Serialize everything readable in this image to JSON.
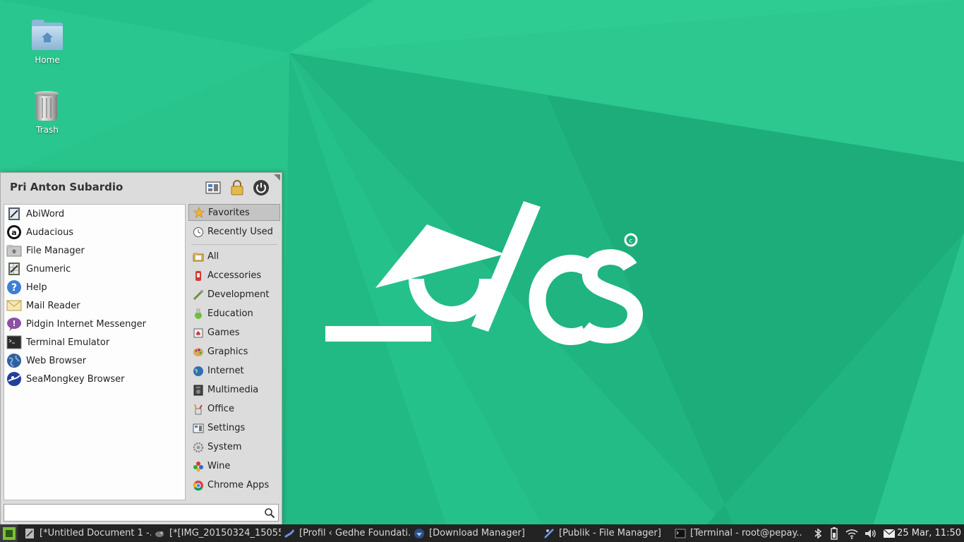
{
  "desktop": {
    "icons": [
      {
        "label": "Home",
        "icon": "home-folder-icon"
      },
      {
        "label": "Trash",
        "icon": "trash-icon"
      }
    ],
    "colors": {
      "background": "#25c18b",
      "logo": "#ffffff"
    }
  },
  "menu": {
    "user_name": "Pri Anton Subardio",
    "favorites": [
      {
        "label": "AbiWord",
        "icon": "abiword-icon"
      },
      {
        "label": "Audacious",
        "icon": "audacious-icon"
      },
      {
        "label": "File Manager",
        "icon": "file-manager-icon"
      },
      {
        "label": "Gnumeric",
        "icon": "gnumeric-icon"
      },
      {
        "label": "Help",
        "icon": "help-icon"
      },
      {
        "label": "Mail Reader",
        "icon": "mail-icon"
      },
      {
        "label": "Pidgin Internet Messenger",
        "icon": "pidgin-icon"
      },
      {
        "label": "Terminal Emulator",
        "icon": "terminal-icon"
      },
      {
        "label": "Web Browser",
        "icon": "web-browser-icon"
      },
      {
        "label": "SeaMongkey Browser",
        "icon": "seamonkey-icon"
      }
    ],
    "categories": [
      {
        "label": "Favorites",
        "icon": "star-icon"
      },
      {
        "label": "Recently Used",
        "icon": "clock-icon"
      },
      {
        "label": "All",
        "icon": "folder-icon"
      },
      {
        "label": "Accessories",
        "icon": "accessories-icon"
      },
      {
        "label": "Development",
        "icon": "development-icon"
      },
      {
        "label": "Education",
        "icon": "education-icon"
      },
      {
        "label": "Games",
        "icon": "games-icon"
      },
      {
        "label": "Graphics",
        "icon": "graphics-icon"
      },
      {
        "label": "Internet",
        "icon": "globe-icon"
      },
      {
        "label": "Multimedia",
        "icon": "multimedia-icon"
      },
      {
        "label": "Office",
        "icon": "office-icon"
      },
      {
        "label": "Settings",
        "icon": "settings-icon"
      },
      {
        "label": "System",
        "icon": "gear-icon"
      },
      {
        "label": "Wine",
        "icon": "wine-icon"
      },
      {
        "label": "Chrome Apps",
        "icon": "chrome-icon"
      }
    ],
    "search_placeholder": ""
  },
  "taskbar": {
    "tasks": [
      {
        "label": "[*Untitled Document 1 -...",
        "icon": "text-editor-icon"
      },
      {
        "label": "[*[IMG_20150324_15055...",
        "icon": "image-editor-icon"
      },
      {
        "label": "[Profil ‹ Gedhe Foundati...",
        "icon": "seamonkey-icon"
      },
      {
        "label": "[Download Manager]",
        "icon": "download-icon"
      },
      {
        "label": "[Publik - File Manager]",
        "icon": "file-manager-icon"
      },
      {
        "label": "[Terminal - root@pepay...",
        "icon": "terminal-icon"
      }
    ],
    "tray": [
      "bluetooth-icon",
      "battery-icon",
      "wifi-icon",
      "volume-icon",
      "mail-icon"
    ],
    "clock": "25 Mar, 11:50"
  }
}
